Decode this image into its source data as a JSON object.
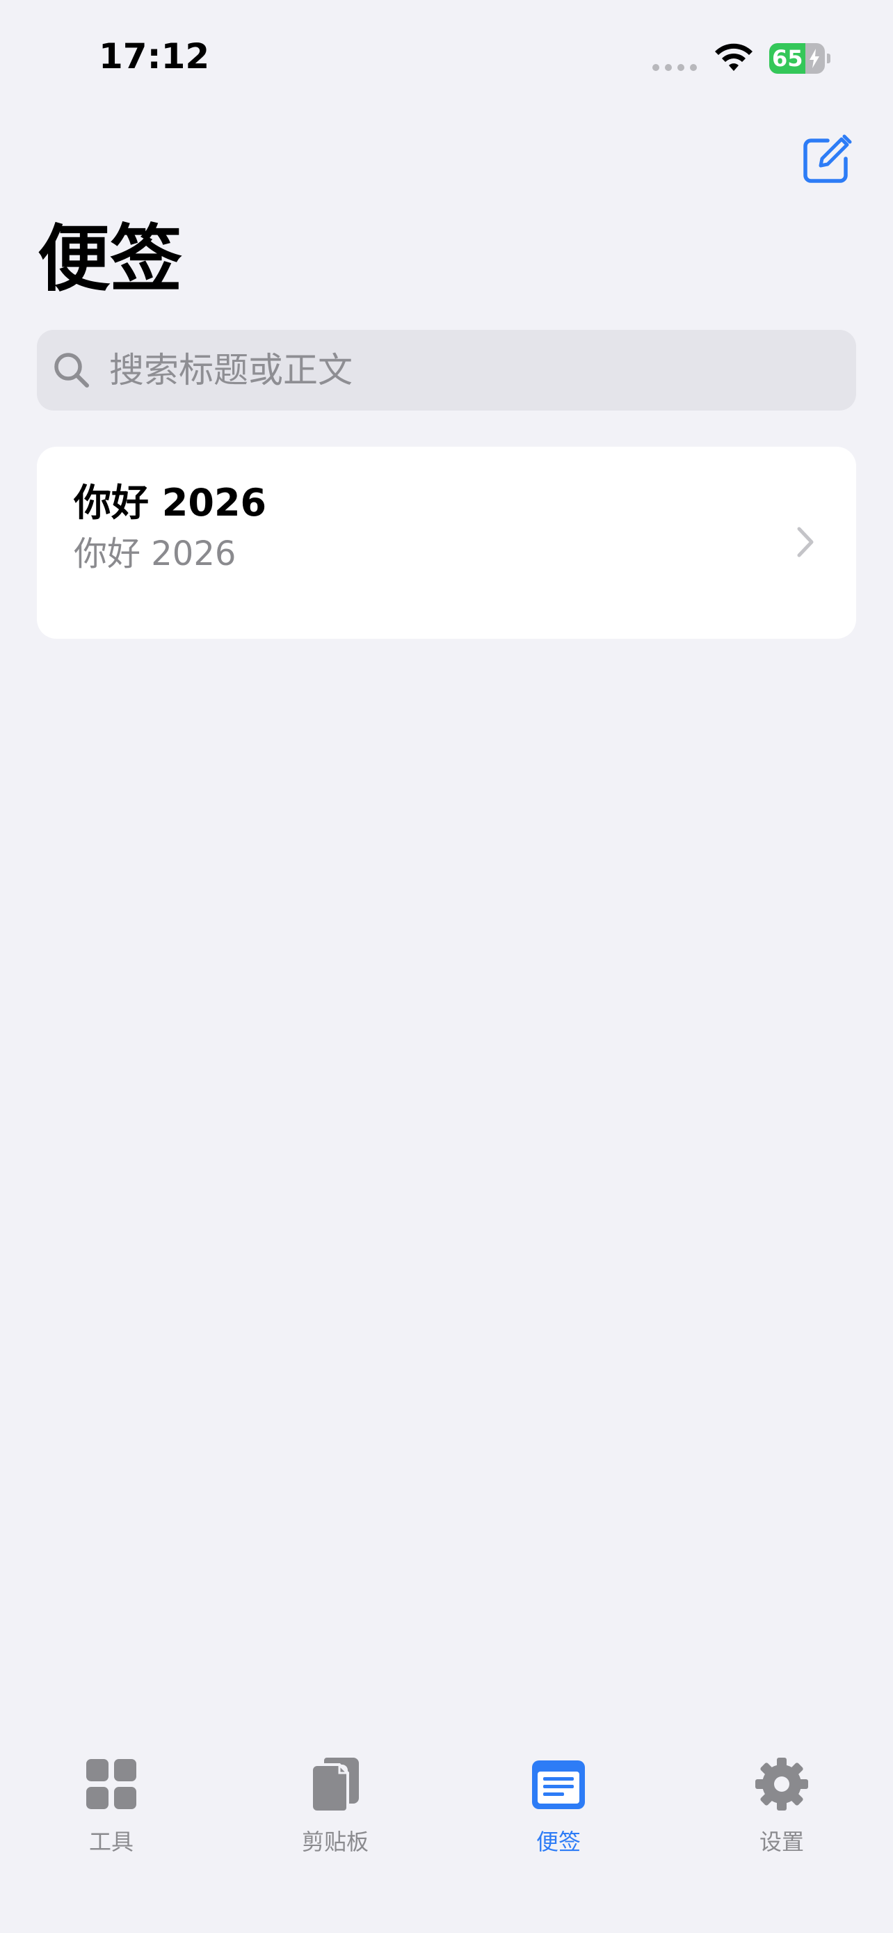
{
  "status_bar": {
    "time": "17:12",
    "battery_level": "65",
    "battery_fraction": 0.65,
    "battery_charging": true,
    "signal_icon": "signal-dots-icon",
    "wifi_icon": "wifi-icon"
  },
  "header": {
    "compose_icon": "compose-icon",
    "title": "便签"
  },
  "search": {
    "placeholder": "搜索标题或正文",
    "value": "",
    "icon": "search-icon"
  },
  "notes": [
    {
      "title": "你好 2026",
      "preview": "你好 2026"
    }
  ],
  "tabs": [
    {
      "label": "工具",
      "icon": "grid-icon",
      "active": false
    },
    {
      "label": "剪贴板",
      "icon": "clipboard-icon",
      "active": false
    },
    {
      "label": "便签",
      "icon": "note-icon",
      "active": true
    },
    {
      "label": "设置",
      "icon": "gear-icon",
      "active": false
    }
  ],
  "colors": {
    "background": "#f2f2f7",
    "accent": "#2d7cf6",
    "inactive": "#8a8a8e",
    "battery_green": "#34c759",
    "card": "#ffffff",
    "search_bg": "#e4e4ea"
  }
}
